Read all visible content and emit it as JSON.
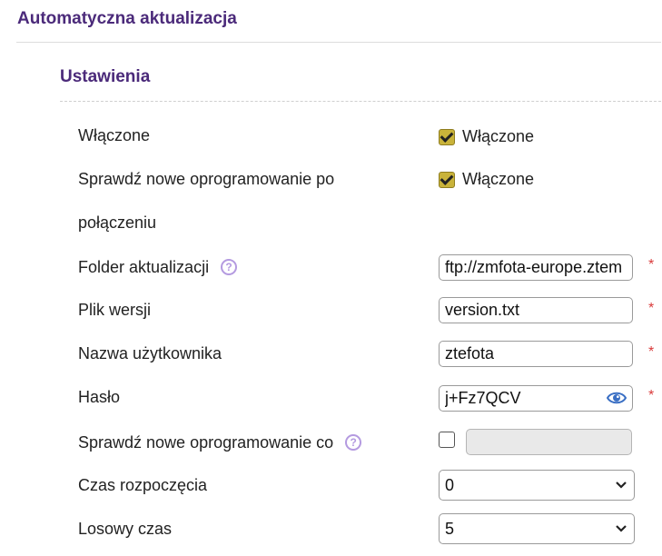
{
  "header": {
    "title": "Automatyczna aktualizacja"
  },
  "section": {
    "title": "Ustawienia"
  },
  "fields": {
    "enabled": {
      "label": "Włączone",
      "checkbox_label": "Włączone",
      "checked": true
    },
    "check_on_connect": {
      "label_line1": "Sprawdź nowe oprogramowanie po",
      "label_line2": "połączeniu",
      "checkbox_label": "Włączone",
      "checked": true
    },
    "update_folder": {
      "label": "Folder aktualizacji",
      "value": "ftp://zmfota-europe.ztem",
      "required_mark": "*"
    },
    "version_file": {
      "label": "Plik wersji",
      "value": "version.txt",
      "required_mark": "*"
    },
    "username": {
      "label": "Nazwa użytkownika",
      "value": "ztefota",
      "required_mark": "*"
    },
    "password": {
      "label": "Hasło",
      "value": "j+Fz7QCV",
      "required_mark": "*"
    },
    "check_interval": {
      "label": "Sprawdź nowe oprogramowanie co",
      "checked": false,
      "value": ""
    },
    "start_time": {
      "label": "Czas rozpoczęcia",
      "value": "0"
    },
    "random_time": {
      "label": "Losowy czas",
      "value": "5"
    }
  },
  "icons": {
    "help": "question-circle-icon",
    "eye": "eye-icon",
    "chevron": "chevron-down-icon"
  },
  "colors": {
    "title": "#4b2a7a",
    "help_icon": "#b49ae0",
    "checkbox_checked": "#c9b33a",
    "required": "#d93a3a",
    "eye": "#3a6fc4"
  }
}
